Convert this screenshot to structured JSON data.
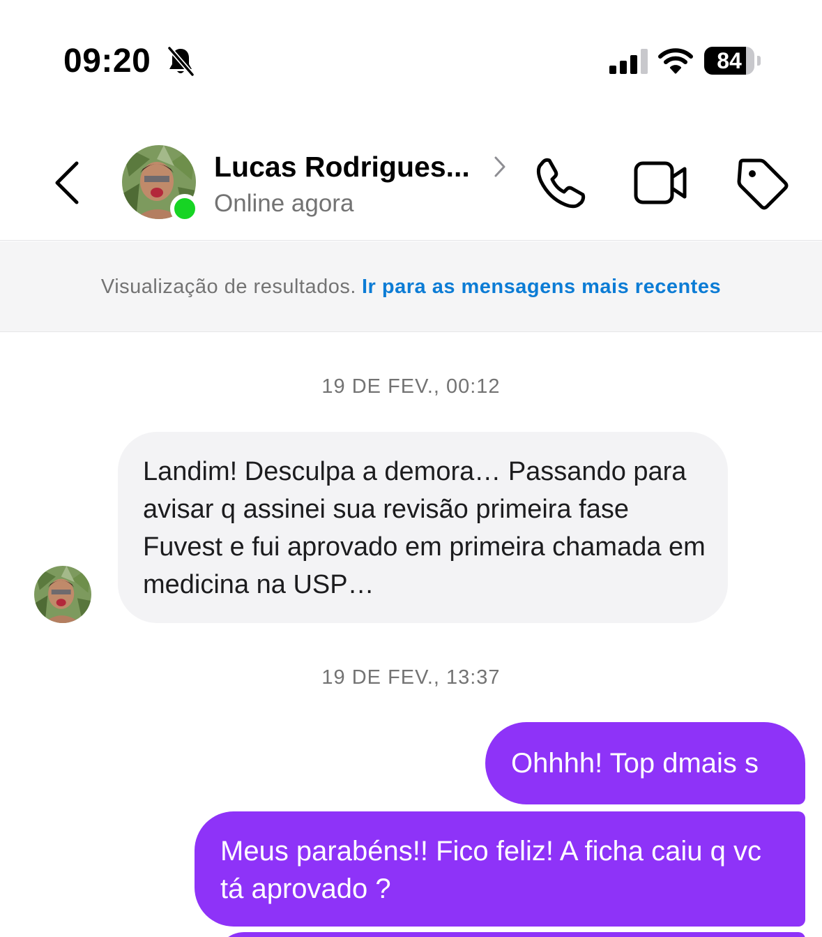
{
  "status_bar": {
    "time": "09:20",
    "battery": "84",
    "battery_level": 0.84,
    "signal_bars": 3,
    "icons": [
      "bell-slash-icon",
      "cellular-signal-icon",
      "wifi-icon",
      "battery-icon"
    ]
  },
  "header": {
    "contact_name": "Lucas Rodrigues...",
    "contact_status": "Online agora",
    "online_color": "#17d424",
    "icons": [
      "chevron-left-icon",
      "chevron-right-icon",
      "phone-icon",
      "video-camera-icon",
      "tag-icon"
    ]
  },
  "banner": {
    "text": "Visualização de resultados.",
    "link": "Ir para as mensagens mais recentes",
    "link_color": "#0c7cd5"
  },
  "conversation": {
    "timestamps": [
      "19 DE FEV., 00:12",
      "19 DE FEV., 13:37"
    ],
    "incoming": [
      {
        "text": "Landim! Desculpa a demora… Passando para avisar q assinei sua revisão primeira fase Fuvest e fui aprovado em primeira chamada em medicina na USP…"
      }
    ],
    "outgoing": [
      {
        "text": "Ohhhh! Top dmais s"
      },
      {
        "text": "Meus parabéns!! Fico feliz! A ficha caiu q vc tá aprovado ?"
      }
    ],
    "outgoing_color": "#8e33f8",
    "incoming_color": "#f3f3f5"
  }
}
